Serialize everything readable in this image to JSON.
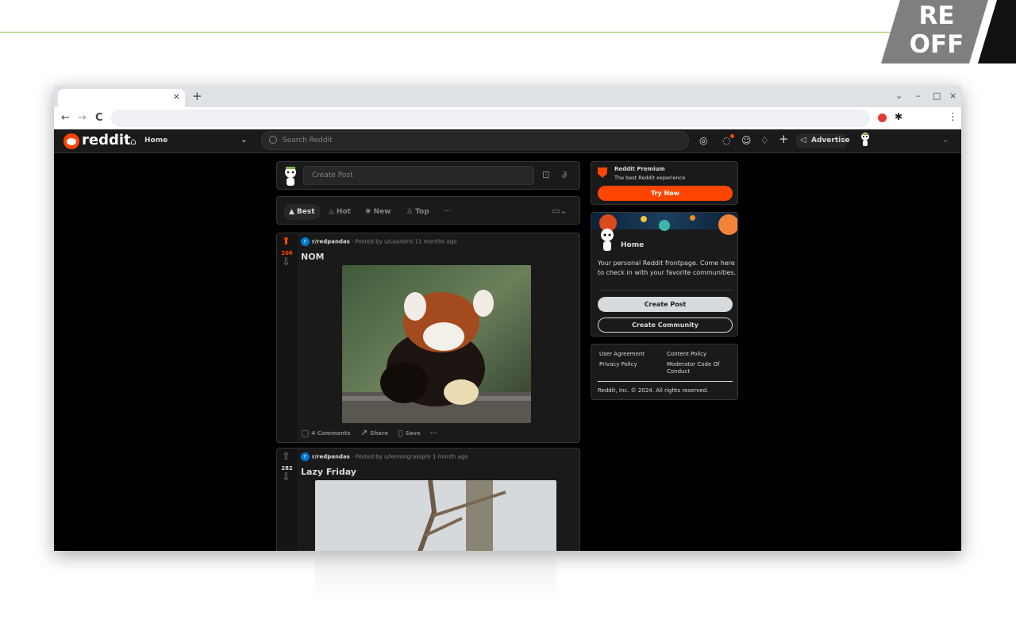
{
  "badge": {
    "line1": "RE",
    "line2": "OFF"
  },
  "browser": {
    "tab_close": "×",
    "new_tab": "+",
    "back": "←",
    "forward": "→",
    "reload": "C",
    "menu": "⋮",
    "minimize": "–",
    "maximize": "□",
    "close": "×",
    "tab_search": "⌄"
  },
  "header": {
    "wordmark": "reddit",
    "home_label": "Home",
    "search_placeholder": "Search Reddit",
    "advertise": "Advertise"
  },
  "create_post": {
    "placeholder": "Create Post"
  },
  "sort": {
    "best": "Best",
    "hot": "Hot",
    "new": "New",
    "top": "Top",
    "more": "···"
  },
  "posts": [
    {
      "subreddit": "r/redpandas",
      "posted_by": " · Posted by u/Loandris 11 months ago",
      "title": "NOM",
      "score": "206",
      "comments": "4 Comments",
      "share": "Share",
      "save": "Save",
      "more": "···"
    },
    {
      "subreddit": "r/redpandas",
      "posted_by": " · Posted by u/lemongrasspm 1 month ago",
      "title": "Lazy Friday",
      "score": "282"
    }
  ],
  "premium": {
    "title": "Reddit Premium",
    "subtitle": "The best Reddit experience",
    "cta": "Try Now"
  },
  "home_card": {
    "title": "Home",
    "description": "Your personal Reddit frontpage. Come here to check in with your favorite communities.",
    "create_post": "Create Post",
    "create_community": "Create Community"
  },
  "footer": {
    "user_agreement": "User Agreement",
    "content_policy": "Content Policy",
    "privacy_policy": "Privacy Policy",
    "moderator_code": "Moderator Code Of Conduct",
    "copyright": "Reddit, Inc. © 2024. All rights reserved."
  },
  "colors": {
    "accent": "#ff4500",
    "bg": "#000000",
    "card": "#1a1a1b",
    "text": "#d7dadc",
    "muted": "#818384"
  }
}
